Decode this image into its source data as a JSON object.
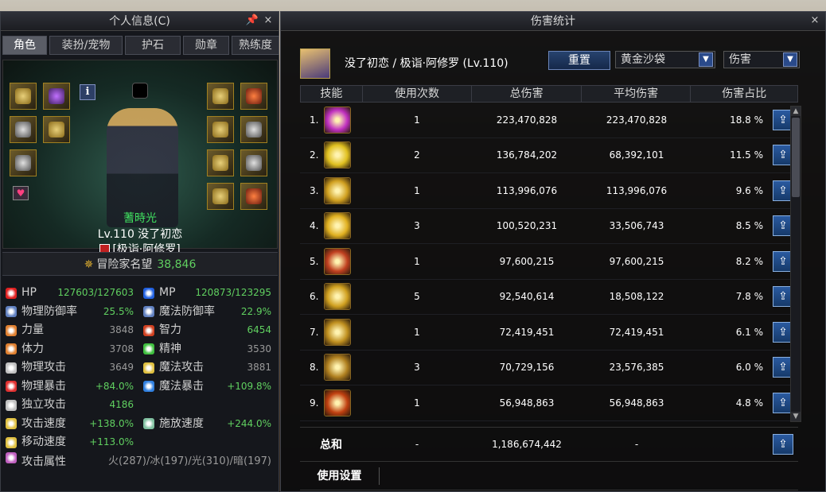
{
  "left_panel": {
    "title": "个人信息(C)",
    "pin_icon": "pin-icon",
    "close": "×",
    "tabs": [
      "角色",
      "装扮/宠物",
      "护石",
      "勋章",
      "熟练度"
    ],
    "info_button": "i",
    "character": {
      "guild": "蓍時光",
      "level_name": "Lv.110  没了初恋",
      "class": "[极诣·阿修罗]"
    },
    "fame": {
      "label": "冒险家名望",
      "value": "38,846"
    },
    "stats": [
      [
        {
          "label": "HP",
          "value": "127603/127603",
          "color": "#e02020"
        },
        {
          "label": "MP",
          "value": "120873/123295",
          "color": "#2060e0"
        }
      ],
      [
        {
          "label": "物理防御率",
          "value": "25.5%",
          "color": "#6080c0"
        },
        {
          "label": "魔法防御率",
          "value": "22.9%",
          "color": "#6080c0"
        }
      ],
      [
        {
          "label": "力量",
          "value": "3848",
          "color": "#e08030"
        },
        {
          "label": "智力",
          "value": "6454",
          "color": "#d04020"
        }
      ],
      [
        {
          "label": "体力",
          "value": "3708",
          "color": "#e08030"
        },
        {
          "label": "精神",
          "value": "3530",
          "color": "#40c040"
        }
      ],
      [
        {
          "label": "物理攻击",
          "value": "3649",
          "color": "#c0c0c0"
        },
        {
          "label": "魔法攻击",
          "value": "3881",
          "color": "#e0c040"
        }
      ],
      [
        {
          "label": "物理暴击",
          "value": "+84.0%",
          "color": "#e03030"
        },
        {
          "label": "魔法暴击",
          "value": "+109.8%",
          "color": "#3080e0"
        }
      ],
      [
        {
          "label": "独立攻击",
          "value": "4186",
          "color": "#c0c0c0"
        },
        {
          "label": "",
          "value": "",
          "color": ""
        }
      ],
      [
        {
          "label": "攻击速度",
          "value": "+138.0%",
          "color": "#e0c040"
        },
        {
          "label": "施放速度",
          "value": "+244.0%",
          "color": "#80c0a0"
        }
      ],
      [
        {
          "label": "移动速度",
          "value": "+113.0%",
          "color": "#e0c040"
        },
        {
          "label": "",
          "value": "",
          "color": ""
        }
      ]
    ],
    "attribute": {
      "label": "攻击属性",
      "value": "火(287)/冰(197)/光(310)/暗(197)"
    }
  },
  "right_panel": {
    "title": "伤害统计",
    "close": "×",
    "player": "没了初恋  / 极诣·阿修罗 (Lv.110)",
    "reset_label": "重置",
    "dropdown_target": "黄金沙袋",
    "dropdown_mode": "伤害",
    "columns": [
      "技能",
      "使用次数",
      "总伤害",
      "平均伤害",
      "伤害占比"
    ],
    "rows": [
      {
        "num": "1.",
        "uses": "1",
        "total": "223,470,828",
        "avg": "223,470,828",
        "pct": "18.8 %",
        "icon_color": "#c030c0"
      },
      {
        "num": "2.",
        "uses": "2",
        "total": "136,784,202",
        "avg": "68,392,101",
        "pct": "11.5 %",
        "icon_color": "#e0c020"
      },
      {
        "num": "3.",
        "uses": "1",
        "total": "113,996,076",
        "avg": "113,996,076",
        "pct": "9.6 %",
        "icon_color": "#d0a020"
      },
      {
        "num": "4.",
        "uses": "3",
        "total": "100,520,231",
        "avg": "33,506,743",
        "pct": "8.5 %",
        "icon_color": "#e0b020"
      },
      {
        "num": "5.",
        "uses": "1",
        "total": "97,600,215",
        "avg": "97,600,215",
        "pct": "8.2 %",
        "icon_color": "#c04020"
      },
      {
        "num": "6.",
        "uses": "5",
        "total": "92,540,614",
        "avg": "18,508,122",
        "pct": "7.8 %",
        "icon_color": "#d0a020"
      },
      {
        "num": "7.",
        "uses": "1",
        "total": "72,419,451",
        "avg": "72,419,451",
        "pct": "6.1 %",
        "icon_color": "#c09020"
      },
      {
        "num": "8.",
        "uses": "3",
        "total": "70,729,156",
        "avg": "23,576,385",
        "pct": "6.0 %",
        "icon_color": "#b08020"
      },
      {
        "num": "9.",
        "uses": "1",
        "total": "56,948,863",
        "avg": "56,948,863",
        "pct": "4.8 %",
        "icon_color": "#c04010"
      }
    ],
    "total": {
      "label": "总和",
      "uses": "-",
      "total": "1,186,674,442",
      "avg": "-"
    },
    "settings_label": "使用设置"
  }
}
